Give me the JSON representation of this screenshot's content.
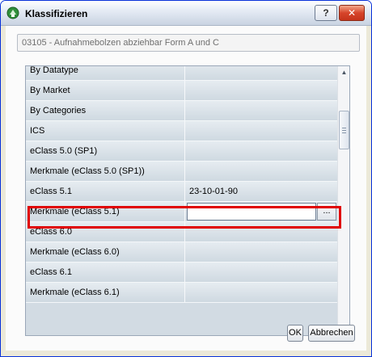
{
  "window": {
    "title": "Klassifizieren",
    "help_label": "?",
    "close_label": "✕"
  },
  "info": {
    "value": "03105 - Aufnahmebolzen abziehbar Form A und C"
  },
  "grid": {
    "rows": [
      {
        "name": "By Datatype",
        "value": ""
      },
      {
        "name": "By Market",
        "value": ""
      },
      {
        "name": "By Categories",
        "value": ""
      },
      {
        "name": "ICS",
        "value": ""
      },
      {
        "name": "eClass 5.0 (SP1)",
        "value": ""
      },
      {
        "name": "Merkmale (eClass 5.0 (SP1))",
        "value": ""
      },
      {
        "name": "eClass 5.1",
        "value": "23-10-01-90"
      },
      {
        "name": "Merkmale (eClass 5.1)",
        "value": "",
        "editing": true
      },
      {
        "name": "eClass 6.0",
        "value": ""
      },
      {
        "name": "Merkmale (eClass 6.0)",
        "value": ""
      },
      {
        "name": "eClass 6.1",
        "value": ""
      },
      {
        "name": "Merkmale (eClass 6.1)",
        "value": ""
      }
    ],
    "browse_label": "...",
    "highlight_color": "#e00000"
  },
  "buttons": {
    "ok": "OK",
    "cancel": "Abbrechen"
  }
}
